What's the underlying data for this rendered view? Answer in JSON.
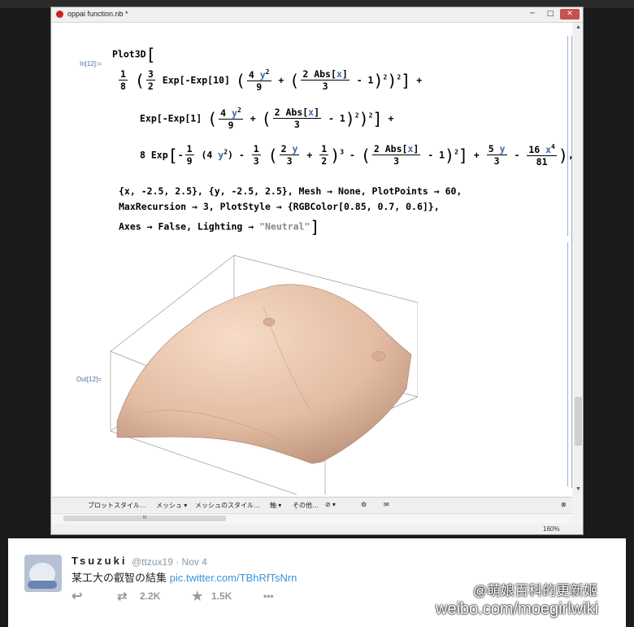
{
  "window": {
    "title": "oppai function.nb *",
    "min": "─",
    "max": "□",
    "close": "✕"
  },
  "cell": {
    "in_label": "In[12]:=",
    "out_label": "Out[12]=",
    "l1_head": "Plot3D",
    "l2_a": "Exp[-Exp[10]",
    "l2_b": "Abs[",
    "l3_a": "Exp[-Exp[1]",
    "l4_a": "8 Exp",
    "l4_b": "(4",
    "l4_c": "Abs[",
    "opt1": "{x, -2.5, 2.5}, {y, -2.5, 2.5}, Mesh → None, PlotPoints → 60,",
    "opt2": "MaxRecursion → 3, PlotStyle → {RGBColor[0.85, 0.7, 0.6]},",
    "opt3a": "Axes → False, Lighting → ",
    "opt3b": "\"Neutral\""
  },
  "toolbar": {
    "item1": "プロットスタイル…",
    "item2": "メッシュ ▾",
    "item3": "メッシュのスタイル…",
    "item4": "軸 ▾",
    "item5": "その他…",
    "item6": "⊘ ▾",
    "item7": "⚙",
    "item8": "✉",
    "close": "⊗"
  },
  "hscroll": {
    "grip": "III"
  },
  "status": {
    "zoom": "160%"
  },
  "tweet": {
    "user": "Tsuzuki",
    "handle": "@ttzux19 · Nov 4",
    "text": "某工大の叡智の結集",
    "link": "pic.twitter.com/TBhRfTsNrn",
    "retweets": "2.2K",
    "favorites": "1.5K",
    "more": "•••"
  },
  "watermark": {
    "line1": "@萌娘百科的更新姬",
    "line2": "weibo.com/moegirlwiki"
  },
  "colors": {
    "surface": "#d9b39a",
    "link": "#3b94d9"
  },
  "icons": [
    "notebook-icon",
    "reply-icon",
    "retweet-icon",
    "star-icon",
    "more-icon"
  ]
}
